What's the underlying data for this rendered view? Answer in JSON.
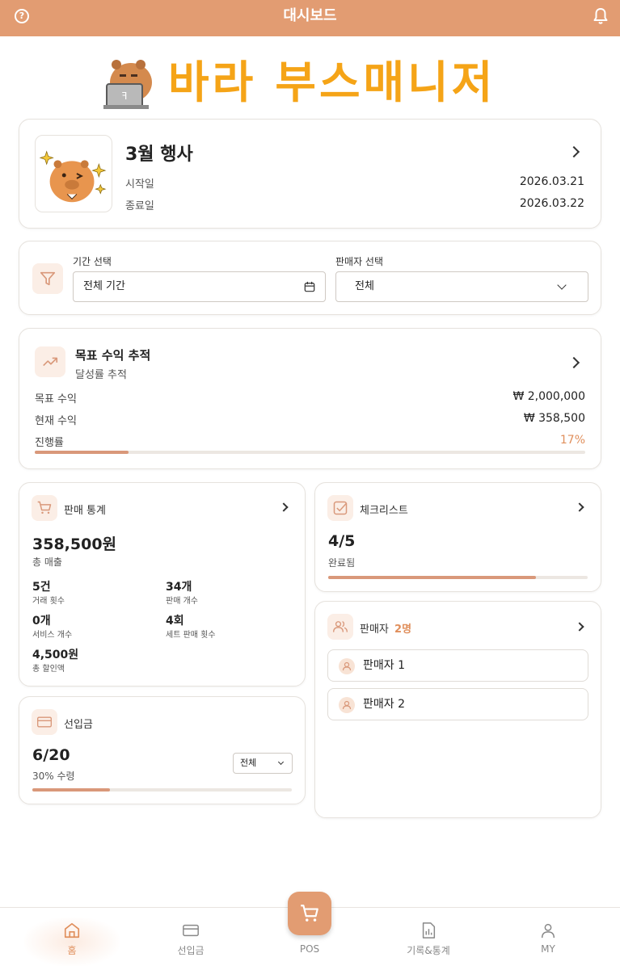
{
  "header": {
    "title": "대시보드"
  },
  "brand": {
    "name": "바라 부스매니저"
  },
  "event": {
    "title": "3월 행사",
    "start_label": "시작일",
    "start_date": "2026.03.21",
    "end_label": "종료일",
    "end_date": "2026.03.22"
  },
  "filter": {
    "period_label": "기간 선택",
    "period_value": "전체 기간",
    "seller_label": "판매자 선택",
    "seller_value": "전체"
  },
  "goal": {
    "title": "목표 수익 추적",
    "subtitle": "달성률 추적",
    "target_label": "목표 수익",
    "target_value": "₩ 2,000,000",
    "current_label": "현재 수익",
    "current_value": "₩ 358,500",
    "progress_label": "진행률",
    "progress_text": "17%",
    "progress_fraction": 0.17
  },
  "sales": {
    "title": "판매 통계",
    "total": "358,500원",
    "total_label": "총 매출",
    "stats": [
      {
        "value": "5건",
        "label": "거래 횟수"
      },
      {
        "value": "34개",
        "label": "판매 개수"
      },
      {
        "value": "0개",
        "label": "서비스 개수"
      },
      {
        "value": "4회",
        "label": "세트 판매 횟수"
      },
      {
        "value": "4,500원",
        "label": "총 할인액"
      }
    ]
  },
  "checklist": {
    "title": "체크리스트",
    "count": "4/5",
    "status": "완료됨",
    "progress_fraction": 0.8
  },
  "sellers": {
    "title": "판매자",
    "count": "2명",
    "items": [
      "판매자 1",
      "판매자 2"
    ]
  },
  "prepaid": {
    "title": "선입금",
    "count": "6/20",
    "status": "30% 수령",
    "filter_value": "전체",
    "progress_fraction": 0.3
  },
  "nav": {
    "home": "홈",
    "prepaid": "선입금",
    "pos": "POS",
    "records": "기록&통계",
    "my": "MY"
  },
  "colors": {
    "header": "#e29c72",
    "brand_text": "#f5a417",
    "accent": "#d9987a",
    "accent_text": "#e08f5c"
  }
}
